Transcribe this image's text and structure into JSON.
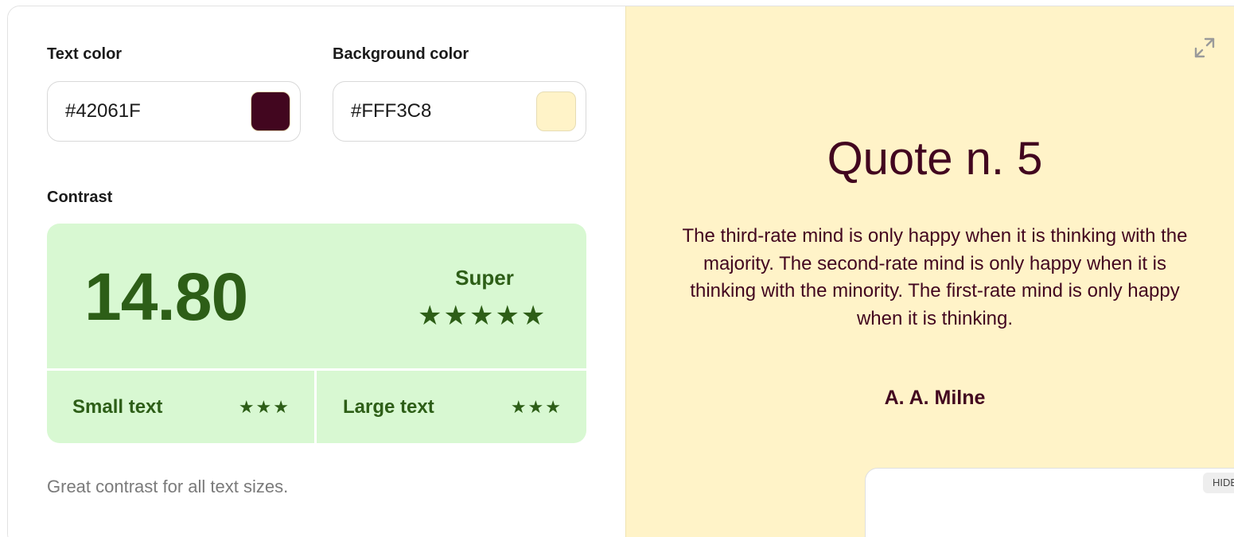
{
  "colors": {
    "text": "#42061F",
    "background": "#FFF3C8",
    "contrast_bg": "#D8F8D2",
    "contrast_fg": "#2D5E17",
    "divider": "#FFFFFF"
  },
  "inputs": {
    "text_color_label": "Text color",
    "text_color_value": "#42061F",
    "background_color_label": "Background color",
    "background_color_value": "#FFF3C8"
  },
  "contrast": {
    "label": "Contrast",
    "ratio": "14.80",
    "rating": "Super",
    "rating_stars": 5,
    "rating_stars_text": "★★★★★",
    "small_text_label": "Small text",
    "small_text_stars": 3,
    "small_text_stars_text": "★★★",
    "large_text_label": "Large text",
    "large_text_stars": 3,
    "large_text_stars_text": "★★★",
    "note": "Great contrast for all text sizes."
  },
  "preview": {
    "title": "Quote n. 5",
    "quote": "The third-rate mind is only happy when it is thinking with the majority. The second-rate mind is only happy when it is thinking with the minority. The first-rate mind is only happy when it is thinking.",
    "author": "A. A. Milne",
    "expand_icon": "expand-icon",
    "hide_label": "HIDE"
  }
}
